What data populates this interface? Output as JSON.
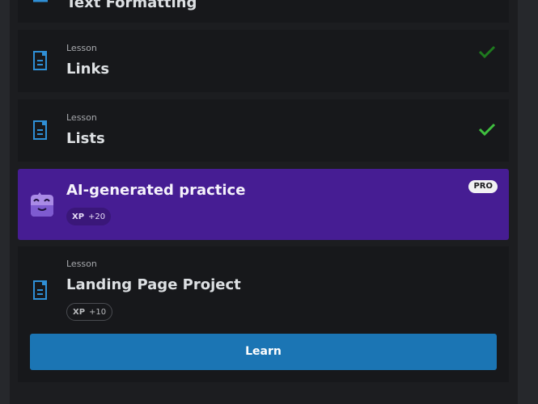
{
  "lessons": [
    {
      "kind": "",
      "title": "Text Formatting",
      "completed": true
    },
    {
      "kind": "Lesson",
      "title": "Links",
      "completed": true
    },
    {
      "kind": "Lesson",
      "title": "Lists",
      "completed": true
    }
  ],
  "ai_practice": {
    "title": "AI-generated practice",
    "xp_label": "XP",
    "xp_value": "+20",
    "pro_badge": "PRO",
    "icon": "mascot-icon"
  },
  "project": {
    "kind": "Lesson",
    "title": "Landing Page Project",
    "xp_label": "XP",
    "xp_value": "+10",
    "button_label": "Learn"
  },
  "colors": {
    "accent_blue": "#1b75b4",
    "ai_purple": "#461d93",
    "check_green": "#3fbf3f",
    "check_green_dim": "#1e7a1e",
    "lesson_icon": "#2f8fd6"
  }
}
